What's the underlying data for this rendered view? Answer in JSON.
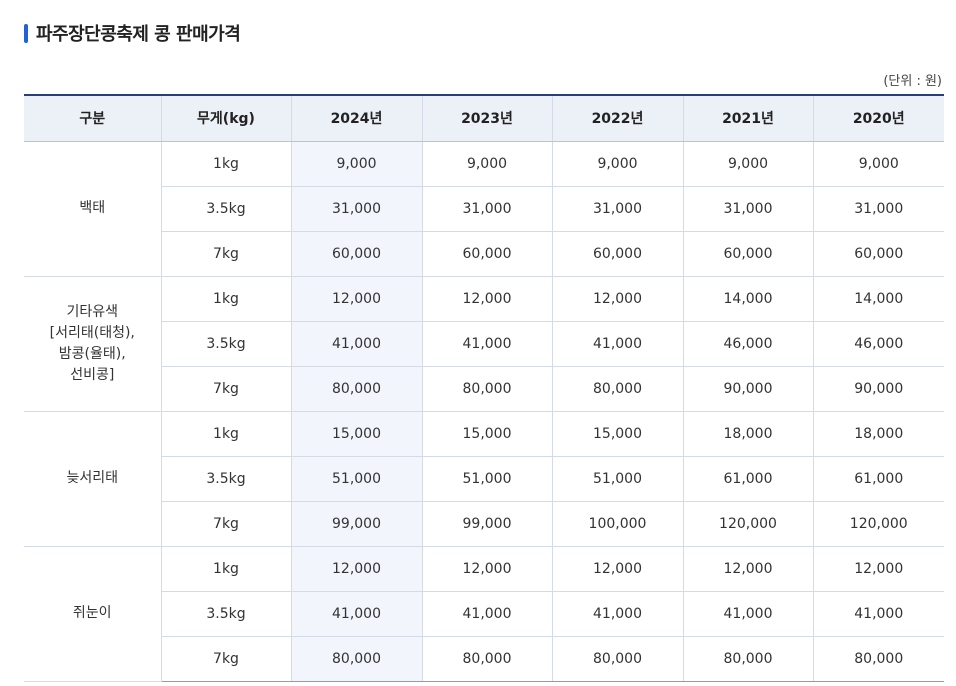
{
  "page": {
    "title": "파주장단콩축제 콩 판매가격",
    "unit": "(단위 : 원)"
  },
  "table": {
    "headers": [
      "구분",
      "무게(kg)",
      "2024년",
      "2023년",
      "2022년",
      "2021년",
      "2020년"
    ],
    "groups": [
      {
        "label": "백태",
        "rows": [
          {
            "weight": "1kg",
            "prices": [
              "9,000",
              "9,000",
              "9,000",
              "9,000",
              "9,000"
            ]
          },
          {
            "weight": "3.5kg",
            "prices": [
              "31,000",
              "31,000",
              "31,000",
              "31,000",
              "31,000"
            ]
          },
          {
            "weight": "7kg",
            "prices": [
              "60,000",
              "60,000",
              "60,000",
              "60,000",
              "60,000"
            ]
          }
        ]
      },
      {
        "label": "기타유색\n[서리태(태청),\n밤콩(율태),\n선비콩]",
        "rows": [
          {
            "weight": "1kg",
            "prices": [
              "12,000",
              "12,000",
              "12,000",
              "14,000",
              "14,000"
            ]
          },
          {
            "weight": "3.5kg",
            "prices": [
              "41,000",
              "41,000",
              "41,000",
              "46,000",
              "46,000"
            ]
          },
          {
            "weight": "7kg",
            "prices": [
              "80,000",
              "80,000",
              "80,000",
              "90,000",
              "90,000"
            ]
          }
        ]
      },
      {
        "label": "늦서리태",
        "rows": [
          {
            "weight": "1kg",
            "prices": [
              "15,000",
              "15,000",
              "15,000",
              "18,000",
              "18,000"
            ]
          },
          {
            "weight": "3.5kg",
            "prices": [
              "51,000",
              "51,000",
              "51,000",
              "61,000",
              "61,000"
            ]
          },
          {
            "weight": "7kg",
            "prices": [
              "99,000",
              "99,000",
              "100,000",
              "120,000",
              "120,000"
            ]
          }
        ]
      },
      {
        "label": "쥐눈이",
        "rows": [
          {
            "weight": "1kg",
            "prices": [
              "12,000",
              "12,000",
              "12,000",
              "12,000",
              "12,000"
            ]
          },
          {
            "weight": "3.5kg",
            "prices": [
              "41,000",
              "41,000",
              "41,000",
              "41,000",
              "41,000"
            ]
          },
          {
            "weight": "7kg",
            "prices": [
              "80,000",
              "80,000",
              "80,000",
              "80,000",
              "80,000"
            ]
          }
        ]
      }
    ]
  }
}
